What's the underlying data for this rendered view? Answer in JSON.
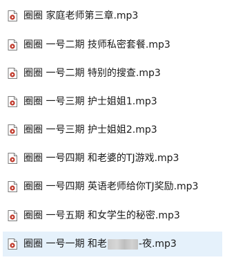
{
  "files": [
    {
      "name": "圈圈 家庭老师第三章.mp3",
      "icon": "audio-file-icon"
    },
    {
      "name": "圈圈 一号二期 技师私密套餐.mp3",
      "icon": "audio-file-icon"
    },
    {
      "name": "圈圈 一号二期 特别的搜查.mp3",
      "icon": "audio-file-icon"
    },
    {
      "name": "圈圈 一号三期 护士姐姐1.mp3",
      "icon": "audio-file-icon"
    },
    {
      "name": "圈圈 一号三期 护士姐姐2.mp3",
      "icon": "audio-file-icon"
    },
    {
      "name": "圈圈 一号四期 和老婆的TJ游戏.mp3",
      "icon": "audio-file-icon"
    },
    {
      "name": "圈圈 一号四期 英语老师给你TJ奖励.mp3",
      "icon": "audio-file-icon"
    },
    {
      "name": "圈圈 一号五期 和女学生的秘密.mp3",
      "icon": "audio-file-icon"
    }
  ],
  "selected_file": {
    "name_prefix": "圈圈 一号一期 和老",
    "name_suffix": "-夜.mp3",
    "icon": "audio-file-icon"
  },
  "colors": {
    "selection_background": "#e5f1fb",
    "icon_accent": "#c0392b"
  }
}
